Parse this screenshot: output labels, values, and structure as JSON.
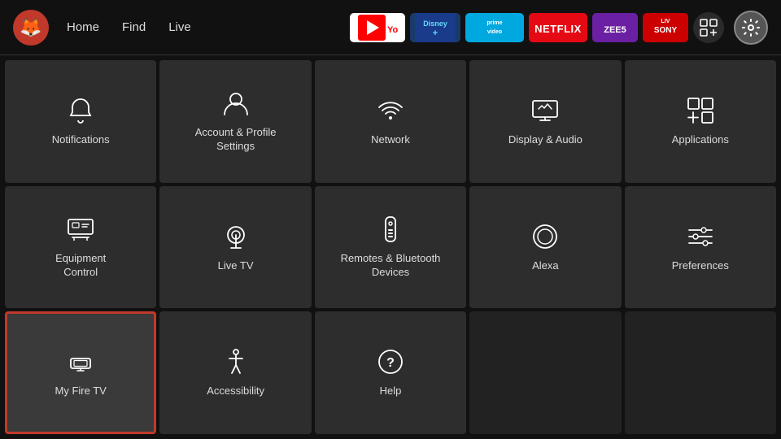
{
  "nav": {
    "logo": "🦊",
    "links": [
      "Home",
      "Find",
      "Live"
    ],
    "apps": [
      {
        "label": "▶ YouTube",
        "class": "app-youtube"
      },
      {
        "label": "disney+",
        "class": "app-disney"
      },
      {
        "label": "prime video",
        "class": "app-prime"
      },
      {
        "label": "NETFLIX",
        "class": "app-netflix"
      },
      {
        "label": "ZEE5",
        "class": "app-zee"
      },
      {
        "label": "SONY",
        "class": "app-sony"
      }
    ],
    "settings_label": "⚙"
  },
  "grid": {
    "items": [
      {
        "id": "notifications",
        "label": "Notifications",
        "icon": "bell"
      },
      {
        "id": "account",
        "label": "Account & Profile\nSettings",
        "icon": "person"
      },
      {
        "id": "network",
        "label": "Network",
        "icon": "wifi"
      },
      {
        "id": "display-audio",
        "label": "Display & Audio",
        "icon": "display"
      },
      {
        "id": "applications",
        "label": "Applications",
        "icon": "apps"
      },
      {
        "id": "equipment",
        "label": "Equipment\nControl",
        "icon": "tv"
      },
      {
        "id": "livetv",
        "label": "Live TV",
        "icon": "antenna"
      },
      {
        "id": "remotes",
        "label": "Remotes & Bluetooth\nDevices",
        "icon": "remote"
      },
      {
        "id": "alexa",
        "label": "Alexa",
        "icon": "alexa"
      },
      {
        "id": "preferences",
        "label": "Preferences",
        "icon": "sliders"
      },
      {
        "id": "myfiretv",
        "label": "My Fire TV",
        "icon": "firetv",
        "selected": true
      },
      {
        "id": "accessibility",
        "label": "Accessibility",
        "icon": "accessibility"
      },
      {
        "id": "help",
        "label": "Help",
        "icon": "help"
      },
      {
        "id": "empty1",
        "label": "",
        "icon": ""
      },
      {
        "id": "empty2",
        "label": "",
        "icon": ""
      }
    ]
  }
}
